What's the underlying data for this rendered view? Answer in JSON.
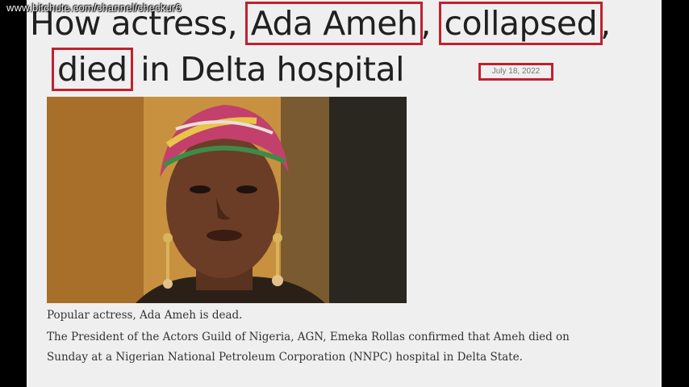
{
  "watermark": "www.bitchute.com/channel/checkur6",
  "headline": {
    "part1": "How actress, ",
    "highlight1": "Ada Ameh",
    "part2": ", ",
    "highlight2": "collapsed",
    "part3": ",",
    "highlight3": "died",
    "part4": " in Delta hospital"
  },
  "date": "July 18, 2022",
  "photo": {
    "subject": "portrait of actress with colorful head wrap and gold earrings"
  },
  "caption": "Popular actress, Ada Ameh is dead.",
  "body": {
    "line1": "The President of the Actors Guild of Nigeria, AGN, Emeka Rollas confirmed that Ameh died on",
    "line2": "Sunday at a Nigerian National Petroleum Corporation (NNPC) hospital in Delta State."
  },
  "colors": {
    "highlight_box": "#c0212f",
    "page_bg": "#efefef",
    "outer_bg": "#000000"
  }
}
